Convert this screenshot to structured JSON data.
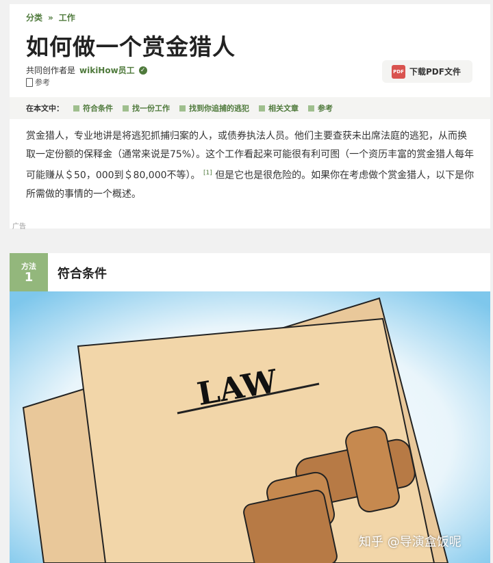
{
  "breadcrumb": {
    "category": "分类",
    "separator": "»",
    "current": "工作"
  },
  "article": {
    "title": "如何做一个赏金猎人",
    "coauthor_prefix": "共同创作者是",
    "coauthor_name": "wikiHow员工",
    "references_label": "参考",
    "pdf_button": "下载PDF文件",
    "pdf_icon_text": "PDF"
  },
  "toc": {
    "label": "在本文中：",
    "items": [
      "符合条件",
      "找一份工作",
      "找到你追捕的逃犯",
      "相关文章",
      "参考"
    ]
  },
  "intro": {
    "text_a": "赏金猎人，专业地讲是将逃犯抓捕归案的人，或债券执法人员。他们主要查获未出席法庭的逃犯，从而换取一定份额的保释金（通常来说是75%）。这个工作看起来可能很有利可图（一个资历丰富的赏金猎人每年可能赚从＄50，000到＄80,000不等）。",
    "ref_mark": "[1]",
    "text_b": "但是它也是很危险的。如果你在考虑做个赏金猎人，以下是你所需做的事情的一个概述。"
  },
  "ad_label": "广告",
  "method": {
    "label": "方法",
    "number": "1",
    "title": "符合条件"
  },
  "illustration": {
    "paper_text": "LAW"
  },
  "watermark": "知乎 @导演盒饭呢"
}
